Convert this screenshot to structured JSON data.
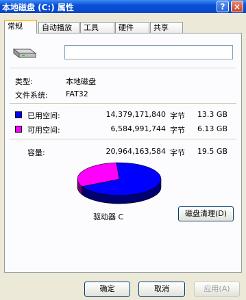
{
  "window": {
    "title": "本地磁盘 (C:) 属性",
    "help_label": "?",
    "close_label": "×"
  },
  "tabs": [
    "常规",
    "自动播放",
    "工具",
    "硬件",
    "共享"
  ],
  "general": {
    "drive_name_value": "",
    "type_label": "类型:",
    "type_value": "本地磁盘",
    "fs_label": "文件系统:",
    "fs_value": "FAT32",
    "used": {
      "label": "已用空间:",
      "bytes": "14,379,171,840",
      "unit": "字节",
      "size": "13.3 GB",
      "color": "#0000ff",
      "fraction": 0.686
    },
    "free": {
      "label": "可用空间:",
      "bytes": "6,584,991,744",
      "unit": "字节",
      "size": "6.13 GB",
      "color": "#ff00ff",
      "fraction": 0.314
    },
    "capacity": {
      "label": "容量:",
      "bytes": "20,964,163,584",
      "unit": "字节",
      "size": "19.5 GB"
    },
    "drive_label": "驱动器 C",
    "cleanup_label": "磁盘清理(D)"
  },
  "buttons": {
    "ok": "确定",
    "cancel": "取消",
    "apply": "应用(A)"
  }
}
